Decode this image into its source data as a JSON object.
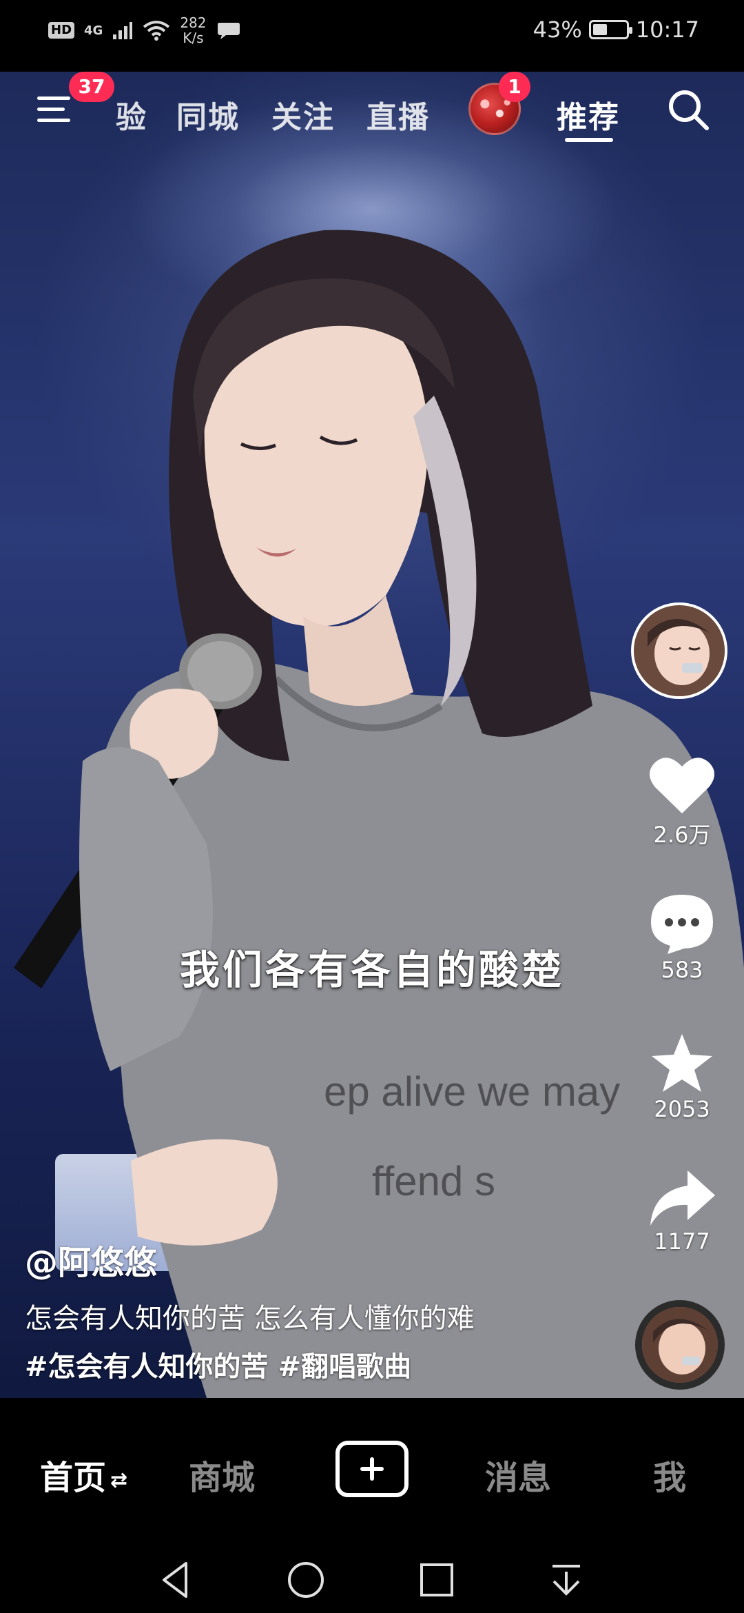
{
  "status_bar": {
    "hd": "HD",
    "network": "4G",
    "speed_value": "282",
    "speed_unit": "K/s",
    "battery_percent": "43%",
    "battery_level": 0.43,
    "time": "10:17",
    "icons": [
      "wifi-icon",
      "signal-icon",
      "chat-bubble-icon",
      "battery-icon"
    ]
  },
  "top_nav": {
    "menu_badge": "37",
    "tabs": [
      {
        "label": "验",
        "active": false
      },
      {
        "label": "同城",
        "active": false
      },
      {
        "label": "关注",
        "active": false
      },
      {
        "label": "直播",
        "active": false
      },
      {
        "label": "推荐",
        "active": true
      }
    ],
    "live_badge": "1",
    "icons": [
      "menu-icon",
      "search-icon"
    ]
  },
  "lyric": "我们各有各自的酸楚",
  "actions": {
    "like_count": "2.6万",
    "comment_count": "583",
    "favorite_count": "2053",
    "share_count": "1177"
  },
  "caption": {
    "author": "@阿悠悠",
    "description": "怎会有人知你的苦 怎么有人懂你的难",
    "tags": [
      "#怎会有人知你的苦",
      "#翻唱歌曲"
    ]
  },
  "bottom_tabs": {
    "home": "首页",
    "home_swap": "⇄",
    "mall": "商城",
    "messages": "消息",
    "me": "我"
  },
  "colors": {
    "badge": "#fe2c55",
    "background": "#000000",
    "inactive_tab": "#8a8a8a"
  }
}
